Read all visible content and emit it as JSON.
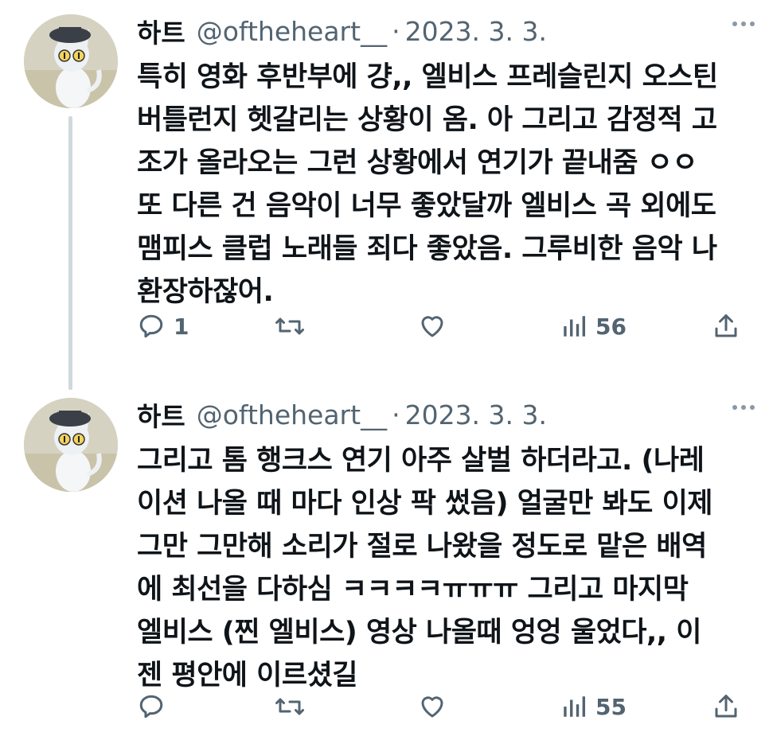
{
  "tweets": [
    {
      "author_name": "하트",
      "handle": "@oftheheart__",
      "separator": "·",
      "date": "2023. 3. 3.",
      "text": "특히 영화 후반부에 걍,, 엘비스 프레슬린지 오스틴\n버틀런지 헷갈리는 상황이 옴. 아 그리고 감정적 고\n조가 올라오는 그런 상황에서 연기가 끝내줌 ㅇㅇ\n또 다른 건 음악이 너무 좋았달까 엘비스 곡 외에도\n맴피스 클럽 노래들 죄다 좋았음. 그루비한 음악 나\n환장하잖어.",
      "reply_count": "1",
      "retweet_count": "",
      "like_count": "",
      "view_count": "56",
      "avatar_icon": "avatar-image",
      "more_icon": "more-horizontal-icon"
    },
    {
      "author_name": "하트",
      "handle": "@oftheheart__",
      "separator": "·",
      "date": "2023. 3. 3.",
      "text": "그리고 톰 행크스 연기 아주 살벌 하더라고. (나레\n이션 나올 때 마다 인상 팍 썼음) 얼굴만 봐도 이제\n그만 그만해 소리가 절로 나왔을 정도로 맡은 배역\n에 최선을 다하심 ㅋㅋㅋㅋㅠㅠㅠ 그리고 마지막\n엘비스 (찐 엘비스) 영상 나올때 엉엉 울었다,, 이\n젠 평안에 이르셨길",
      "reply_count": "",
      "retweet_count": "",
      "like_count": "",
      "view_count": "55",
      "avatar_icon": "avatar-image",
      "more_icon": "more-horizontal-icon"
    }
  ],
  "colors": {
    "text_primary": "#0f1419",
    "text_secondary": "#536471",
    "thread_line": "#cfd9de"
  }
}
